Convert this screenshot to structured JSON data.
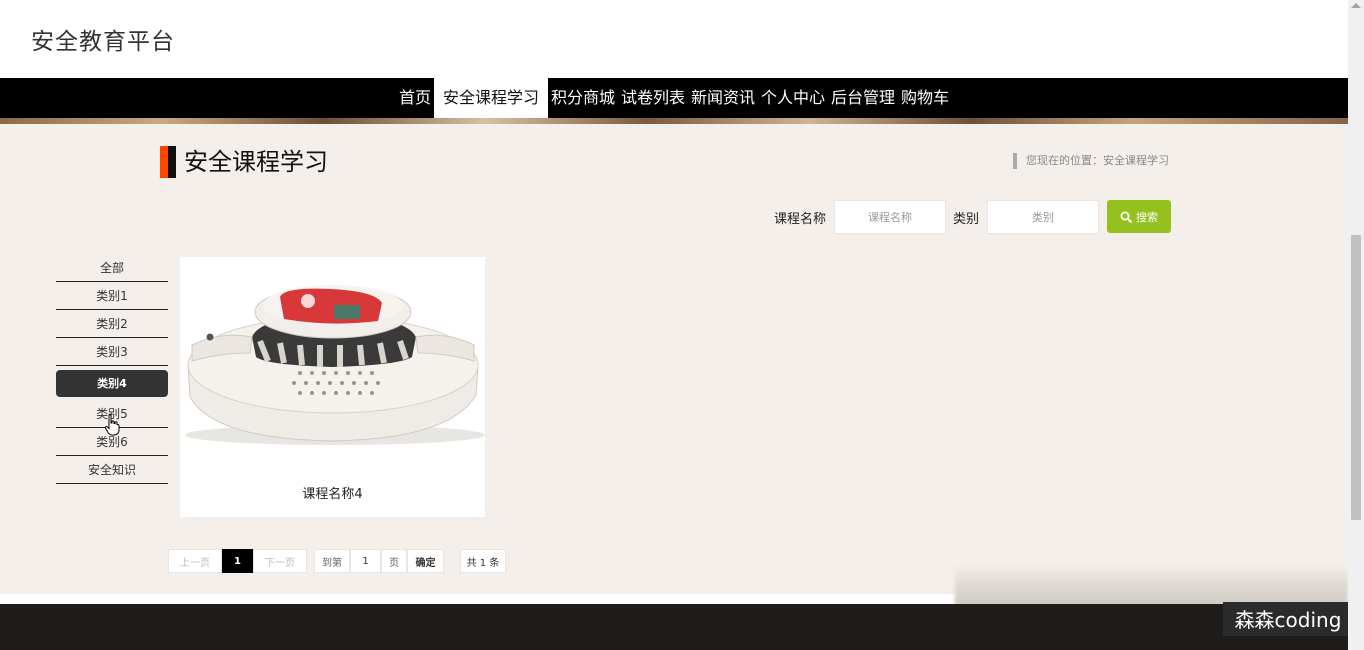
{
  "site": {
    "title": "安全教育平台"
  },
  "nav": {
    "items": [
      {
        "label": "首页"
      },
      {
        "label": "安全课程学习"
      },
      {
        "label": "积分商城"
      },
      {
        "label": "试卷列表"
      },
      {
        "label": "新闻资讯"
      },
      {
        "label": "个人中心"
      },
      {
        "label": "后台管理"
      },
      {
        "label": "购物车"
      }
    ],
    "active_index": 1
  },
  "page": {
    "title": "安全课程学习",
    "breadcrumb": "您现在的位置：安全课程学习"
  },
  "search": {
    "course_label": "课程名称",
    "course_placeholder": "课程名称",
    "category_label": "类别",
    "category_placeholder": "类别",
    "button_label": "搜索",
    "button_color": "#95c11f"
  },
  "categories": {
    "items": [
      "全部",
      "类别1",
      "类别2",
      "类别3",
      "类别4",
      "类别5",
      "类别6",
      "安全知识"
    ],
    "active_index": 4
  },
  "courses": [
    {
      "name": "课程名称4",
      "image": "smoke-detector"
    }
  ],
  "pagination": {
    "prev_label": "上一页",
    "current_page": "1",
    "next_label": "下一页",
    "goto_label": "到第",
    "goto_value": "1",
    "page_unit": "页",
    "confirm_label": "确定",
    "total_label": "共 1 条"
  },
  "watermark": "森森coding",
  "colors": {
    "accent": "#ff4500",
    "nav_bg": "#000000",
    "page_bg": "#f4efea",
    "footer_bg": "#1f1c1c"
  }
}
